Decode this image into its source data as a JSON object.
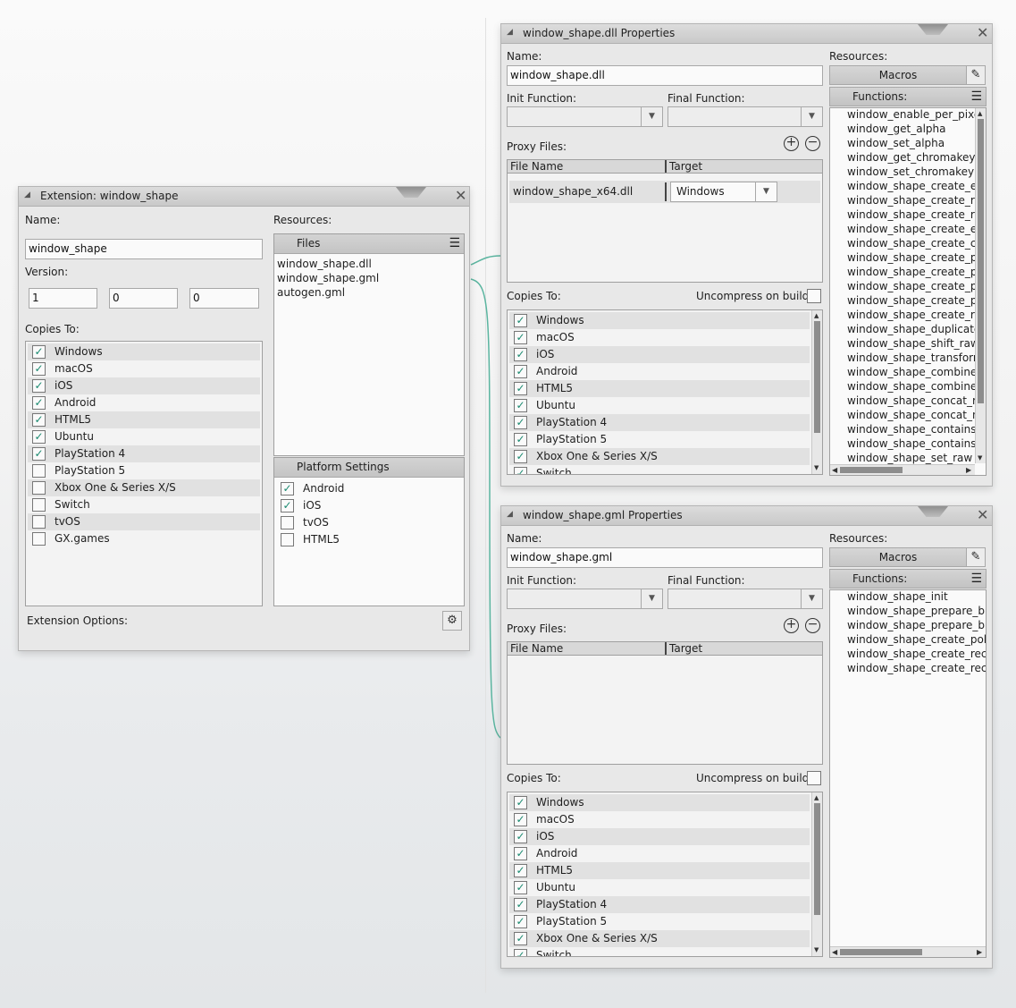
{
  "ext": {
    "title": "Extension: window_shape",
    "name_label": "Name:",
    "name_value": "window_shape",
    "version_label": "Version:",
    "version": [
      "1",
      "0",
      "0"
    ],
    "copies_label": "Copies To:",
    "copies": [
      {
        "label": "Windows",
        "checked": true
      },
      {
        "label": "macOS",
        "checked": true
      },
      {
        "label": "iOS",
        "checked": true
      },
      {
        "label": "Android",
        "checked": true
      },
      {
        "label": "HTML5",
        "checked": true
      },
      {
        "label": "Ubuntu",
        "checked": true
      },
      {
        "label": "PlayStation 4",
        "checked": true
      },
      {
        "label": "PlayStation 5",
        "checked": false
      },
      {
        "label": "Xbox One & Series X/S",
        "checked": false
      },
      {
        "label": "Switch",
        "checked": false
      },
      {
        "label": "tvOS",
        "checked": false
      },
      {
        "label": "GX.games",
        "checked": false
      }
    ],
    "resources_label": "Resources:",
    "files_header": "Files",
    "files": [
      "window_shape.dll",
      "window_shape.gml",
      "autogen.gml"
    ],
    "platform_header": "Platform Settings",
    "platforms": [
      {
        "label": "Android",
        "checked": true
      },
      {
        "label": "iOS",
        "checked": true
      },
      {
        "label": "tvOS",
        "checked": false
      },
      {
        "label": "HTML5",
        "checked": false
      }
    ],
    "options_label": "Extension Options:"
  },
  "dll": {
    "title": "window_shape.dll Properties",
    "name_label": "Name:",
    "name_value": "window_shape.dll",
    "init_label": "Init Function:",
    "final_label": "Final Function:",
    "proxy_label": "Proxy Files:",
    "col_file": "File Name",
    "col_target": "Target",
    "proxy_file": "window_shape_x64.dll",
    "proxy_target": "Windows",
    "copies_label": "Copies To:",
    "uncompress_label": "Uncompress on build",
    "copies": [
      {
        "label": "Windows",
        "checked": true
      },
      {
        "label": "macOS",
        "checked": true
      },
      {
        "label": "iOS",
        "checked": true
      },
      {
        "label": "Android",
        "checked": true
      },
      {
        "label": "HTML5",
        "checked": true
      },
      {
        "label": "Ubuntu",
        "checked": true
      },
      {
        "label": "PlayStation 4",
        "checked": true
      },
      {
        "label": "PlayStation 5",
        "checked": true
      },
      {
        "label": "Xbox One & Series X/S",
        "checked": true
      },
      {
        "label": "Switch",
        "checked": true
      }
    ],
    "resources_label": "Resources:",
    "macros_label": "Macros",
    "functions_label": "Functions:",
    "functions": [
      "window_enable_per_pixel",
      "window_get_alpha",
      "window_set_alpha",
      "window_get_chromakey",
      "window_set_chromakey",
      "window_shape_create_em",
      "window_shape_create_rec",
      "window_shape_create_rou",
      "window_shape_create_ell",
      "window_shape_create_cir",
      "window_shape_create_po",
      "window_shape_create_po",
      "window_shape_create_po",
      "window_shape_create_po",
      "window_shape_create_rec",
      "window_shape_duplicate_",
      "window_shape_shift_raw",
      "window_shape_transform",
      "window_shape_combine_r",
      "window_shape_combine_r",
      "window_shape_concat_ra",
      "window_shape_concat_nc",
      "window_shape_contains_",
      "window_shape_contains_r",
      "window_shape_set_raw"
    ]
  },
  "gml": {
    "title": "window_shape.gml Properties",
    "name_label": "Name:",
    "name_value": "window_shape.gml",
    "init_label": "Init Function:",
    "final_label": "Final Function:",
    "proxy_label": "Proxy Files:",
    "col_file": "File Name",
    "col_target": "Target",
    "copies_label": "Copies To:",
    "uncompress_label": "Uncompress on build",
    "copies": [
      {
        "label": "Windows",
        "checked": true
      },
      {
        "label": "macOS",
        "checked": true
      },
      {
        "label": "iOS",
        "checked": true
      },
      {
        "label": "Android",
        "checked": true
      },
      {
        "label": "HTML5",
        "checked": true
      },
      {
        "label": "Ubuntu",
        "checked": true
      },
      {
        "label": "PlayStation 4",
        "checked": true
      },
      {
        "label": "PlayStation 5",
        "checked": true
      },
      {
        "label": "Xbox One & Series X/S",
        "checked": true
      },
      {
        "label": "Switch",
        "checked": true
      }
    ],
    "resources_label": "Resources:",
    "macros_label": "Macros",
    "functions_label": "Functions:",
    "functions": [
      "window_shape_init",
      "window_shape_prepare_buf",
      "window_shape_prepare_buf",
      "window_shape_create_polyg",
      "window_shape_create_recta",
      "window_shape_create_recta"
    ]
  },
  "icons": {
    "collapse": "collapse-triangle-icon",
    "close": "close-icon",
    "menu": "hamburger-menu-icon",
    "edit": "pencil-icon",
    "add": "plus-circle-icon",
    "remove": "minus-circle-icon",
    "settings": "gear-icon",
    "check": "checkmark-icon"
  },
  "colors": {
    "check": "#1a8a70",
    "link": "#5bb5a0",
    "titlebar": "#cfcfcf"
  }
}
